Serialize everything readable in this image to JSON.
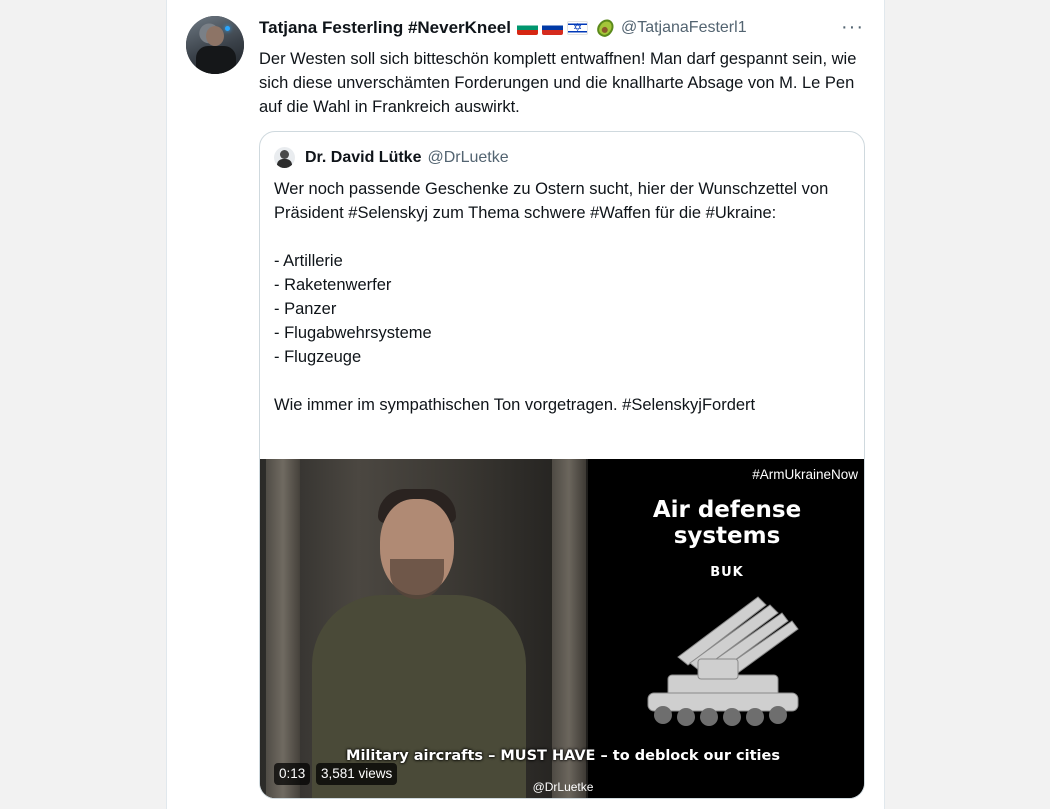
{
  "tweet": {
    "author_name": "Tatjana Festerling #NeverKneel",
    "author_handle": "@TatjanaFesterl1",
    "flag_icons": [
      "bulgaria-flag",
      "russia-flag",
      "israel-flag",
      "avocado-emoji"
    ],
    "more_icon": "···",
    "text": "Der Westen soll sich bitteschön komplett entwaffnen! Man darf gespannt sein, wie sich diese unverschämten Forderungen und die knallharte Absage von M. Le Pen auf die Wahl in Frankreich auswirkt."
  },
  "quote": {
    "author_name": "Dr. David Lütke",
    "author_handle": "@DrLuetke",
    "text": "Wer noch passende Geschenke zu Ostern sucht, hier der Wunschzettel von Präsident #Selenskyj zum Thema schwere #Waffen für die #Ukraine:\n\n- Artillerie\n- Raketenwerfer\n- Panzer\n- Flugabwehrsysteme\n- Flugzeuge\n\nWie immer im sympathischen Ton vorgetragen. #SelenskyjFordert",
    "video": {
      "hashtag_overlay": "#ArmUkraineNow",
      "title_overlay": "Air defense\nsystems",
      "subtitle_overlay": "BUK",
      "caption": "Military aircrafts – MUST HAVE – to deblock our cities",
      "duration": "0:13",
      "views": "3,581 views",
      "watermark": "@DrLuetke"
    }
  },
  "colors": {
    "page_bg": "#f2f2f2",
    "card_bg": "#ffffff",
    "text_primary": "#0f1419",
    "text_secondary": "#536471",
    "border": "#cfd9de"
  }
}
